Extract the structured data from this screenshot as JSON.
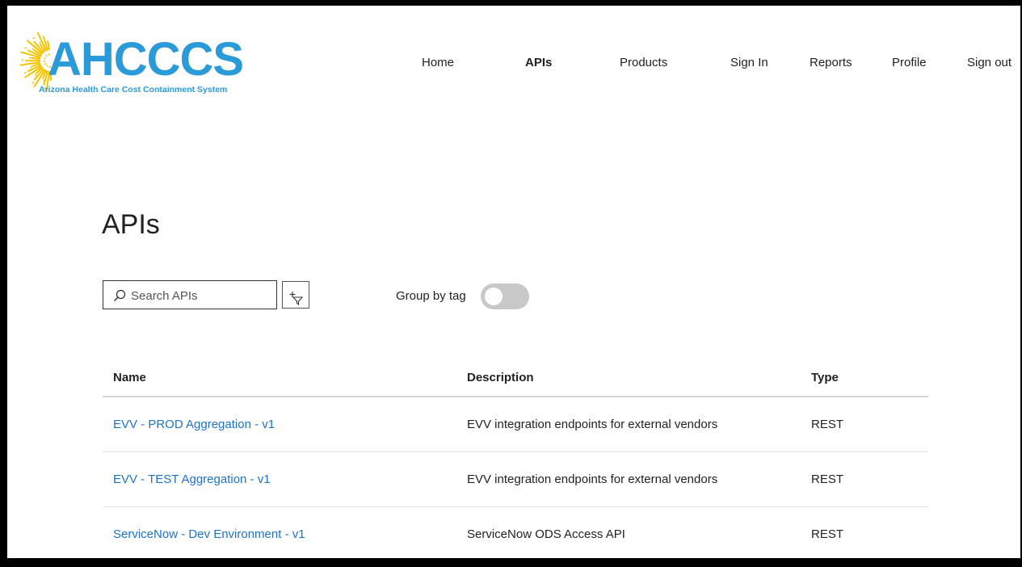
{
  "brand": {
    "logo_text": "AHCCCS",
    "tagline": "Arizona Health Care Cost Containment System",
    "color": "#2b9ad8",
    "sun_color": "#f5c400"
  },
  "nav": {
    "items": [
      {
        "label": "Home",
        "active": false
      },
      {
        "label": "APIs",
        "active": true
      },
      {
        "label": "Products",
        "active": false
      },
      {
        "label": "Sign In",
        "active": false
      },
      {
        "label": "Reports",
        "active": false
      },
      {
        "label": "Profile",
        "active": false
      },
      {
        "label": "Sign out",
        "active": false
      }
    ]
  },
  "page": {
    "title": "APIs"
  },
  "search": {
    "placeholder": "Search APIs",
    "value": ""
  },
  "filter": {
    "icon": "add-filter-icon"
  },
  "group_by_tag": {
    "label": "Group by tag",
    "enabled": false
  },
  "table": {
    "headers": [
      "Name",
      "Description",
      "Type"
    ],
    "rows": [
      {
        "name": "EVV - PROD Aggregation - v1",
        "description": "EVV integration endpoints for external vendors",
        "type": "REST"
      },
      {
        "name": "EVV - TEST Aggregation - v1",
        "description": "EVV integration endpoints for external vendors",
        "type": "REST"
      },
      {
        "name": "ServiceNow - Dev Environment - v1",
        "description": "ServiceNow ODS Access API",
        "type": "REST"
      }
    ]
  },
  "colors": {
    "link": "#1d73c9",
    "toggle_off": "#c8c8c8"
  }
}
